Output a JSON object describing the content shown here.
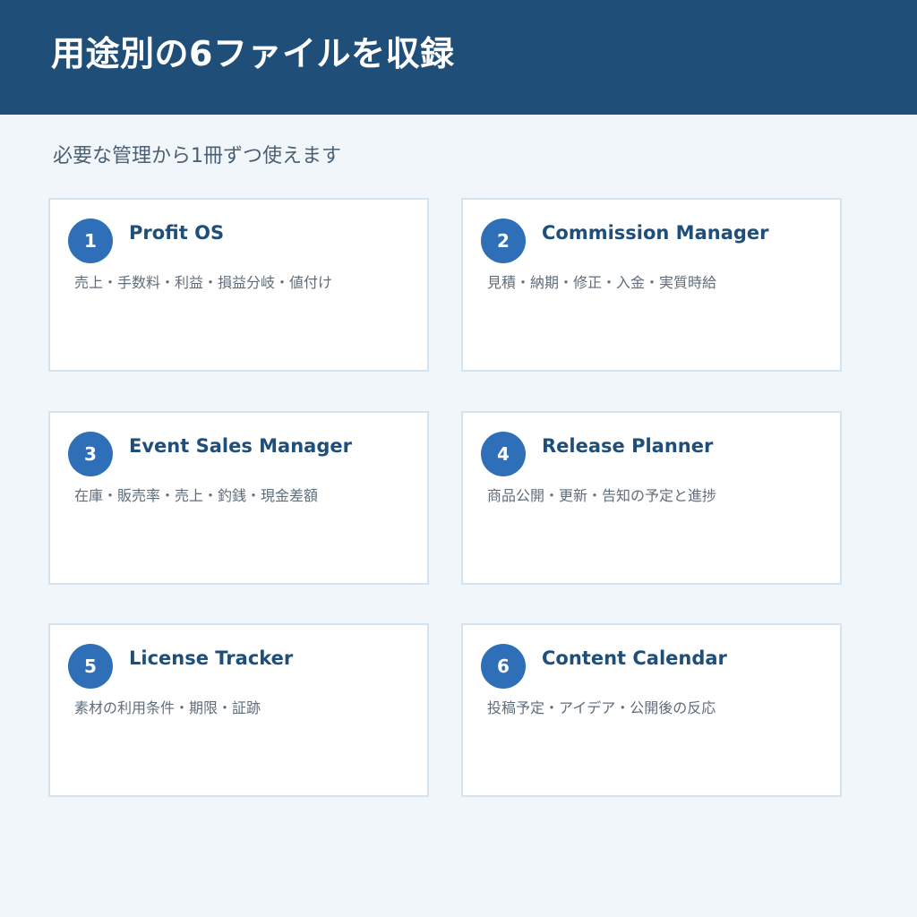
{
  "header": {
    "title": "用途別の6ファイルを収録"
  },
  "subtitle": "必要な管理から1冊ずつ使えます",
  "cards": [
    {
      "number": "1",
      "title": "Profit OS",
      "description": "売上・手数料・利益・損益分岐・値付け"
    },
    {
      "number": "2",
      "title": "Commission Manager",
      "description": "見積・納期・修正・入金・実質時給"
    },
    {
      "number": "3",
      "title": "Event Sales Manager",
      "description": "在庫・販売率・売上・釣銭・現金差額"
    },
    {
      "number": "4",
      "title": "Release Planner",
      "description": "商品公開・更新・告知の予定と進捗"
    },
    {
      "number": "5",
      "title": "License Tracker",
      "description": "素材の利用条件・期限・証跡"
    },
    {
      "number": "6",
      "title": "Content Calendar",
      "description": "投稿予定・アイデア・公開後の反応"
    }
  ],
  "colors": {
    "header_background": "#1f4e79",
    "page_background": "#f1f6fa",
    "badge": "#2e6fb7",
    "card_border": "#d5e2ef"
  }
}
